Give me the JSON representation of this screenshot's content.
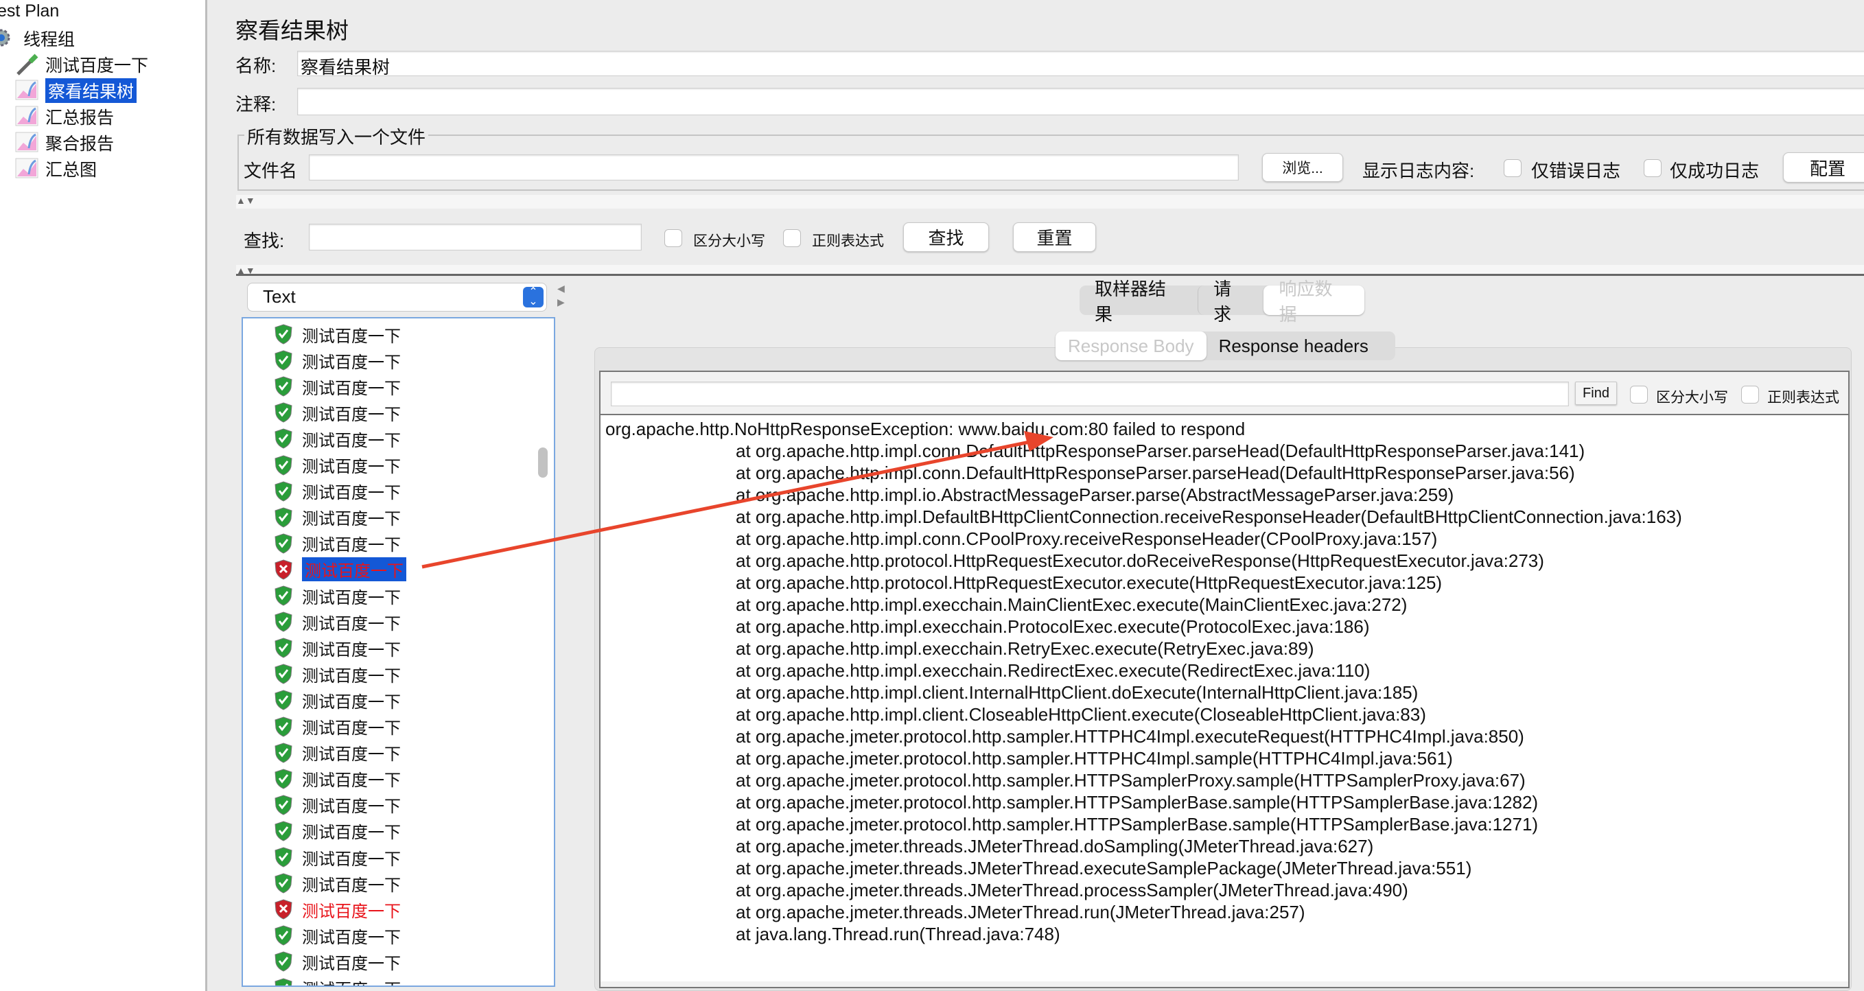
{
  "tree": {
    "root": "est Plan",
    "thread_group": "线程组",
    "items": [
      {
        "label": "测试百度一下",
        "icon": "sampler-pipette-icon"
      },
      {
        "label": "察看结果树",
        "icon": "listener-graph-icon",
        "selected": true
      },
      {
        "label": "汇总报告",
        "icon": "listener-graph-icon"
      },
      {
        "label": "聚合报告",
        "icon": "listener-graph-icon"
      },
      {
        "label": "汇总图",
        "icon": "listener-graph-icon"
      }
    ]
  },
  "panel": {
    "title": "察看结果树",
    "name_label": "名称:",
    "name_value": "察看结果树",
    "comment_label": "注释:",
    "comment_value": "",
    "file_group_label": "所有数据写入一个文件",
    "filename_label": "文件名",
    "filename_value": "",
    "browse_button": "浏览...",
    "log_label": "显示日志内容:",
    "errors_only": "仅错误日志",
    "success_only": "仅成功日志",
    "configure_button": "配置",
    "search_label": "查找:",
    "search_value": "",
    "case_sensitive": "区分大小写",
    "regex": "正则表达式",
    "search_button": "查找",
    "reset_button": "重置"
  },
  "results": {
    "renderer": "Text",
    "rows": [
      {
        "label": "测试百度一下",
        "status": "success"
      },
      {
        "label": "测试百度一下",
        "status": "success"
      },
      {
        "label": "测试百度一下",
        "status": "success"
      },
      {
        "label": "测试百度一下",
        "status": "success"
      },
      {
        "label": "测试百度一下",
        "status": "success"
      },
      {
        "label": "测试百度一下",
        "status": "success"
      },
      {
        "label": "测试百度一下",
        "status": "success"
      },
      {
        "label": "测试百度一下",
        "status": "success"
      },
      {
        "label": "测试百度一下",
        "status": "success"
      },
      {
        "label": "测试百度一下",
        "status": "error",
        "selected": true
      },
      {
        "label": "测试百度一下",
        "status": "success"
      },
      {
        "label": "测试百度一下",
        "status": "success"
      },
      {
        "label": "测试百度一下",
        "status": "success"
      },
      {
        "label": "测试百度一下",
        "status": "success"
      },
      {
        "label": "测试百度一下",
        "status": "success"
      },
      {
        "label": "测试百度一下",
        "status": "success"
      },
      {
        "label": "测试百度一下",
        "status": "success"
      },
      {
        "label": "测试百度一下",
        "status": "success"
      },
      {
        "label": "测试百度一下",
        "status": "success"
      },
      {
        "label": "测试百度一下",
        "status": "success"
      },
      {
        "label": "测试百度一下",
        "status": "success"
      },
      {
        "label": "测试百度一下",
        "status": "success"
      },
      {
        "label": "测试百度一下",
        "status": "error"
      },
      {
        "label": "测试百度一下",
        "status": "success"
      },
      {
        "label": "测试百度一下",
        "status": "success"
      },
      {
        "label": "测试百度一下",
        "status": "success"
      }
    ]
  },
  "detail": {
    "tabs": [
      {
        "label": "取样器结果"
      },
      {
        "label": "请求"
      },
      {
        "label": "响应数据",
        "selected": true
      }
    ],
    "subtabs": [
      {
        "label": "Response Body",
        "selected": true
      },
      {
        "label": "Response headers"
      }
    ],
    "find_value": "",
    "find_button": "Find",
    "case_sensitive": "区分大小写",
    "regex": "正则表达式",
    "response_lines": [
      "org.apache.http.NoHttpResponseException: www.baidu.com:80 failed to respond",
      "at org.apache.http.impl.conn.DefaultHttpResponseParser.parseHead(DefaultHttpResponseParser.java:141)",
      "at org.apache.http.impl.conn.DefaultHttpResponseParser.parseHead(DefaultHttpResponseParser.java:56)",
      "at org.apache.http.impl.io.AbstractMessageParser.parse(AbstractMessageParser.java:259)",
      "at org.apache.http.impl.DefaultBHttpClientConnection.receiveResponseHeader(DefaultBHttpClientConnection.java:163)",
      "at org.apache.http.impl.conn.CPoolProxy.receiveResponseHeader(CPoolProxy.java:157)",
      "at org.apache.http.protocol.HttpRequestExecutor.doReceiveResponse(HttpRequestExecutor.java:273)",
      "at org.apache.http.protocol.HttpRequestExecutor.execute(HttpRequestExecutor.java:125)",
      "at org.apache.http.impl.execchain.MainClientExec.execute(MainClientExec.java:272)",
      "at org.apache.http.impl.execchain.ProtocolExec.execute(ProtocolExec.java:186)",
      "at org.apache.http.impl.execchain.RetryExec.execute(RetryExec.java:89)",
      "at org.apache.http.impl.execchain.RedirectExec.execute(RedirectExec.java:110)",
      "at org.apache.http.impl.client.InternalHttpClient.doExecute(InternalHttpClient.java:185)",
      "at org.apache.http.impl.client.CloseableHttpClient.execute(CloseableHttpClient.java:83)",
      "at org.apache.jmeter.protocol.http.sampler.HTTPHC4Impl.executeRequest(HTTPHC4Impl.java:850)",
      "at org.apache.jmeter.protocol.http.sampler.HTTPHC4Impl.sample(HTTPHC4Impl.java:561)",
      "at org.apache.jmeter.protocol.http.sampler.HTTPSamplerProxy.sample(HTTPSamplerProxy.java:67)",
      "at org.apache.jmeter.protocol.http.sampler.HTTPSamplerBase.sample(HTTPSamplerBase.java:1282)",
      "at org.apache.jmeter.protocol.http.sampler.HTTPSamplerBase.sample(HTTPSamplerBase.java:1271)",
      "at org.apache.jmeter.threads.JMeterThread.doSampling(JMeterThread.java:627)",
      "at org.apache.jmeter.threads.JMeterThread.executeSamplePackage(JMeterThread.java:551)",
      "at org.apache.jmeter.threads.JMeterThread.processSampler(JMeterThread.java:490)",
      "at org.apache.jmeter.threads.JMeterThread.run(JMeterThread.java:257)",
      "at java.lang.Thread.run(Thread.java:748)"
    ]
  },
  "colors": {
    "selection": "#1458d6",
    "error_text": "#e8141b",
    "success_shield": "#2a9d3a",
    "error_shield": "#c8202a",
    "annotation_arrow": "#e8452c"
  }
}
